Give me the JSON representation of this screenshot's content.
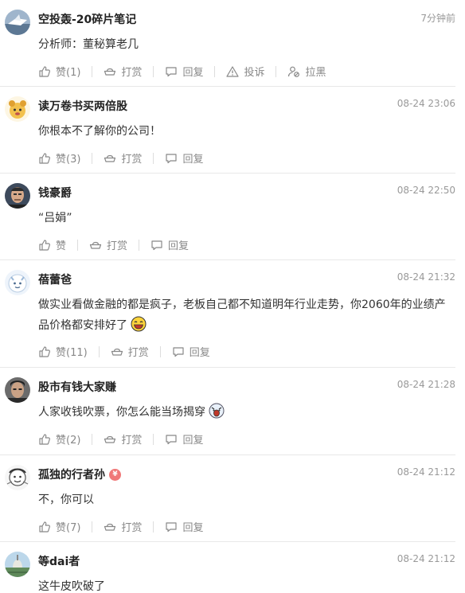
{
  "comments": [
    {
      "username": "空投轰-20碎片笔记",
      "time": "7分钟前",
      "text": "分析师：董秘算老几",
      "like_label": "赞(1)",
      "tip_label": "打赏",
      "reply_label": "回复",
      "report_label": "投诉",
      "block_label": "拉黑"
    },
    {
      "username": "读万卷书买两倍股",
      "time": "08-24 23:06",
      "text": "你根本不了解你的公司！",
      "like_label": "赞(3)",
      "tip_label": "打赏",
      "reply_label": "回复"
    },
    {
      "username": "钱豪爵",
      "time": "08-24 22:50",
      "text": "“吕娟”",
      "like_label": "赞",
      "tip_label": "打赏",
      "reply_label": "回复"
    },
    {
      "username": "蓓蕾爸",
      "time": "08-24 21:32",
      "text": "做实业看做金融的都是疯子，老板自己都不知道明年行业走势，你2060年的业绩产品价格都安排好了",
      "like_label": "赞(11)",
      "tip_label": "打赏",
      "reply_label": "回复"
    },
    {
      "username": "股市有钱大家赚",
      "time": "08-24 21:28",
      "text": "人家收钱吹票，你怎么能当场揭穿",
      "like_label": "赞(2)",
      "tip_label": "打赏",
      "reply_label": "回复"
    },
    {
      "username": "孤独的行者孙",
      "badge": "¥",
      "time": "08-24 21:12",
      "text": "不，你可以",
      "like_label": "赞(7)",
      "tip_label": "打赏",
      "reply_label": "回复"
    },
    {
      "username": "等dai者",
      "time": "08-24 21:12",
      "text": "这牛皮吹破了"
    }
  ],
  "colors": {
    "username": "#222222",
    "time": "#999999",
    "action": "#888888",
    "badge": "#f07878",
    "divider": "#e8e8e8"
  },
  "icons": [
    "thumbs-up-icon",
    "ingot-icon",
    "comment-icon",
    "warning-icon",
    "block-user-icon",
    "laugh-emoji-icon",
    "shocked-emoji-icon"
  ]
}
